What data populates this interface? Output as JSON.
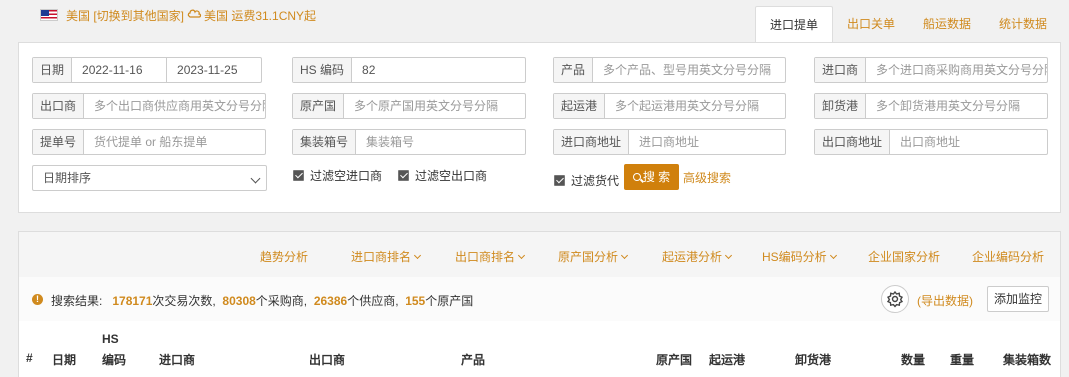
{
  "topbar": {
    "country_label": "美国 [切换到其他国家]",
    "freight_label": "美国 运费31.1CNY起"
  },
  "tabs": [
    {
      "label": "进口提单",
      "active": true
    },
    {
      "label": "出口关单",
      "active": false
    },
    {
      "label": "船运数据",
      "active": false
    },
    {
      "label": "统计数据",
      "active": false
    }
  ],
  "search": {
    "date": {
      "label": "日期",
      "start": "2022-11-16",
      "end": "2023-11-25"
    },
    "hs_code": {
      "label": "HS 编码",
      "value": "82"
    },
    "product": {
      "label": "产品",
      "placeholder": "多个产品、型号用英文分号分隔"
    },
    "importer": {
      "label": "进口商",
      "placeholder": "多个进口商采购商用英文分号分隔"
    },
    "exporter": {
      "label": "出口商",
      "placeholder": "多个出口商供应商用英文分号分隔"
    },
    "origin_country": {
      "label": "原产国",
      "placeholder": "多个原产国用英文分号分隔"
    },
    "departure_port": {
      "label": "起运港",
      "placeholder": "多个起运港用英文分号分隔"
    },
    "discharge_port": {
      "label": "卸货港",
      "placeholder": "多个卸货港用英文分号分隔"
    },
    "bill_no": {
      "label": "提单号",
      "placeholder": "货代提单 or 船东提单"
    },
    "container_no": {
      "label": "集装箱号",
      "placeholder": "集装箱号"
    },
    "importer_address": {
      "label": "进口商地址",
      "placeholder": "进口商地址"
    },
    "exporter_address": {
      "label": "出口商地址",
      "placeholder": "出口商地址"
    },
    "sort": {
      "selected": "日期排序"
    },
    "filters": {
      "empty_importer": "过滤空进口商",
      "empty_exporter": "过滤空出口商",
      "forwarder": "过滤货代"
    },
    "search_button": "搜 索",
    "advanced_link": "高级搜索"
  },
  "analysis_tabs": [
    {
      "label": "趋势分析",
      "dropdown": false
    },
    {
      "label": "进口商排名",
      "dropdown": true
    },
    {
      "label": "出口商排名",
      "dropdown": true
    },
    {
      "label": "原产国分析",
      "dropdown": true
    },
    {
      "label": "起运港分析",
      "dropdown": true
    },
    {
      "label": "HS编码分析",
      "dropdown": true
    },
    {
      "label": "企业国家分析",
      "dropdown": false
    },
    {
      "label": "企业编码分析",
      "dropdown": false
    }
  ],
  "summary": {
    "prefix": "搜索结果:",
    "transactions": "178171",
    "transactions_suffix": "次交易次数,",
    "buyers": "80308",
    "buyers_suffix": "个采购商,",
    "suppliers": "26386",
    "suppliers_suffix": "个供应商,",
    "origins": "155",
    "origins_suffix": "个原产国"
  },
  "actions": {
    "export": "(导出数据)",
    "monitor": "添加监控"
  },
  "table": {
    "columns": {
      "index": "#",
      "date": "日期",
      "hs_line1": "HS",
      "hs_line2": "编码",
      "importer": "进口商",
      "exporter": "出口商",
      "product": "产品",
      "origin": "原产国",
      "departure_port": "起运港",
      "discharge_port": "卸货港",
      "quantity": "数量",
      "weight": "重量",
      "containers": "集装箱数"
    }
  },
  "colors": {
    "accent": "#d08a1e",
    "button": "#d0800c"
  }
}
